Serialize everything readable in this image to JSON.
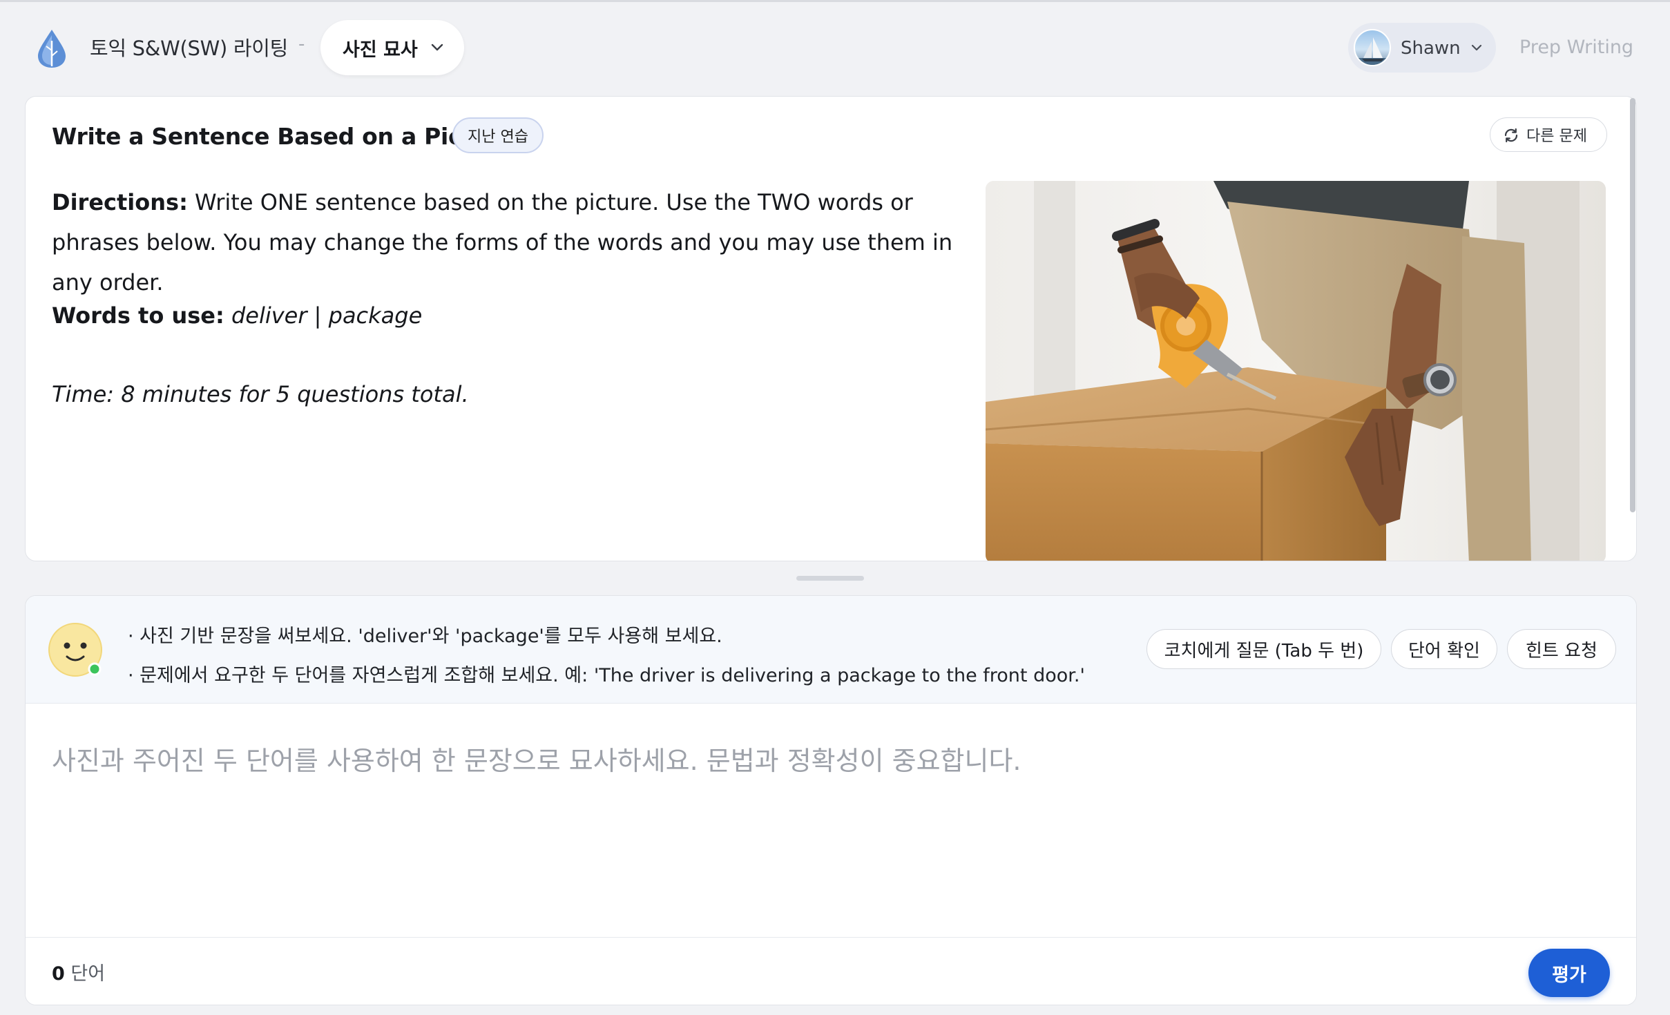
{
  "header": {
    "app_title": "토익 S&W(SW) 라이팅",
    "separator": "-",
    "mode_label": "사진 묘사",
    "user_name": "Shawn",
    "prep_link": "Prep Writing"
  },
  "question": {
    "title": "Write a Sentence Based on a Picture",
    "badge": "지난 연습",
    "other_button": "다른 문제",
    "directions_label": "Directions:",
    "directions_text": " Write ONE sentence based on the picture. Use the TWO words or phrases below. You may change the forms of the words and you may use them in any order.",
    "words_label": "Words to use:",
    "words": "deliver | package",
    "time_text": "Time: 8 minutes for 5 questions total."
  },
  "coach": {
    "tips": [
      "· 사진 기반 문장을 써보세요. 'deliver'와 'package'를 모두 사용해 보세요.",
      "· 문제에서 요구한 두 단어를 자연스럽게 조합해 보세요. 예: 'The driver is delivering a package to the front door.'"
    ],
    "ask_button": "코치에게 질문 (Tab 두 번)",
    "check_button": "단어 확인",
    "hint_button": "힌트 요청"
  },
  "answer": {
    "placeholder": "사진과 주어진 두 단어를 사용하여 한 문장으로 묘사하세요. 문법과 정확성이 중요합니다.",
    "value": ""
  },
  "footer": {
    "word_count": "0",
    "word_unit": " 단어",
    "evaluate_button": "평가"
  },
  "colors": {
    "accent": "#1e5fd6",
    "page_bg": "#f1f2f5",
    "status_online": "#3cc45c"
  }
}
